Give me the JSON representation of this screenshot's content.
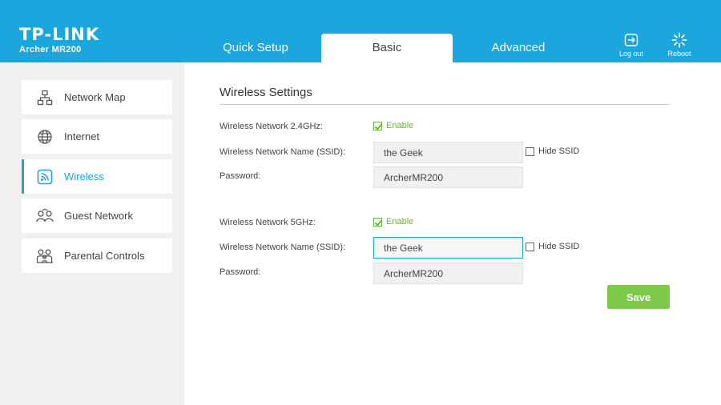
{
  "brand": {
    "logo": "TP-LINK",
    "model": "Archer MR200"
  },
  "nav": {
    "tabs": [
      {
        "label": "Quick Setup"
      },
      {
        "label": "Basic"
      },
      {
        "label": "Advanced"
      }
    ],
    "active": "Basic"
  },
  "header_actions": {
    "logout_label": "Log out",
    "reboot_label": "Reboot"
  },
  "sidebar": {
    "items": [
      {
        "label": "Network Map",
        "icon": "network-map-icon"
      },
      {
        "label": "Internet",
        "icon": "globe-icon"
      },
      {
        "label": "Wireless",
        "icon": "wireless-icon",
        "active": true
      },
      {
        "label": "Guest Network",
        "icon": "guest-network-icon"
      },
      {
        "label": "Parental Controls",
        "icon": "parental-controls-icon"
      }
    ]
  },
  "main": {
    "title": "Wireless Settings",
    "band_24": {
      "label": "Wireless Network 2.4GHz:",
      "enable_label": "Enable",
      "enabled": true,
      "ssid_label": "Wireless Network Name (SSID):",
      "ssid_value": "the Geek",
      "hide_ssid_label": "Hide SSID",
      "hide_ssid": false,
      "password_label": "Password:",
      "password_value": "ArcherMR200"
    },
    "band_5": {
      "label": "Wireless Network 5GHz:",
      "enable_label": "Enable",
      "enabled": true,
      "ssid_label": "Wireless Network Name (SSID):",
      "ssid_value": "the Geek",
      "hide_ssid_label": "Hide SSID",
      "hide_ssid": false,
      "password_label": "Password:",
      "password_value": "ArcherMR200"
    },
    "save_label": "Save"
  },
  "colors": {
    "accent": "#1ba7de",
    "enable_green": "#6cb33f",
    "save_green": "#7dc94a",
    "sidebar_bg": "#f0f0f0"
  }
}
